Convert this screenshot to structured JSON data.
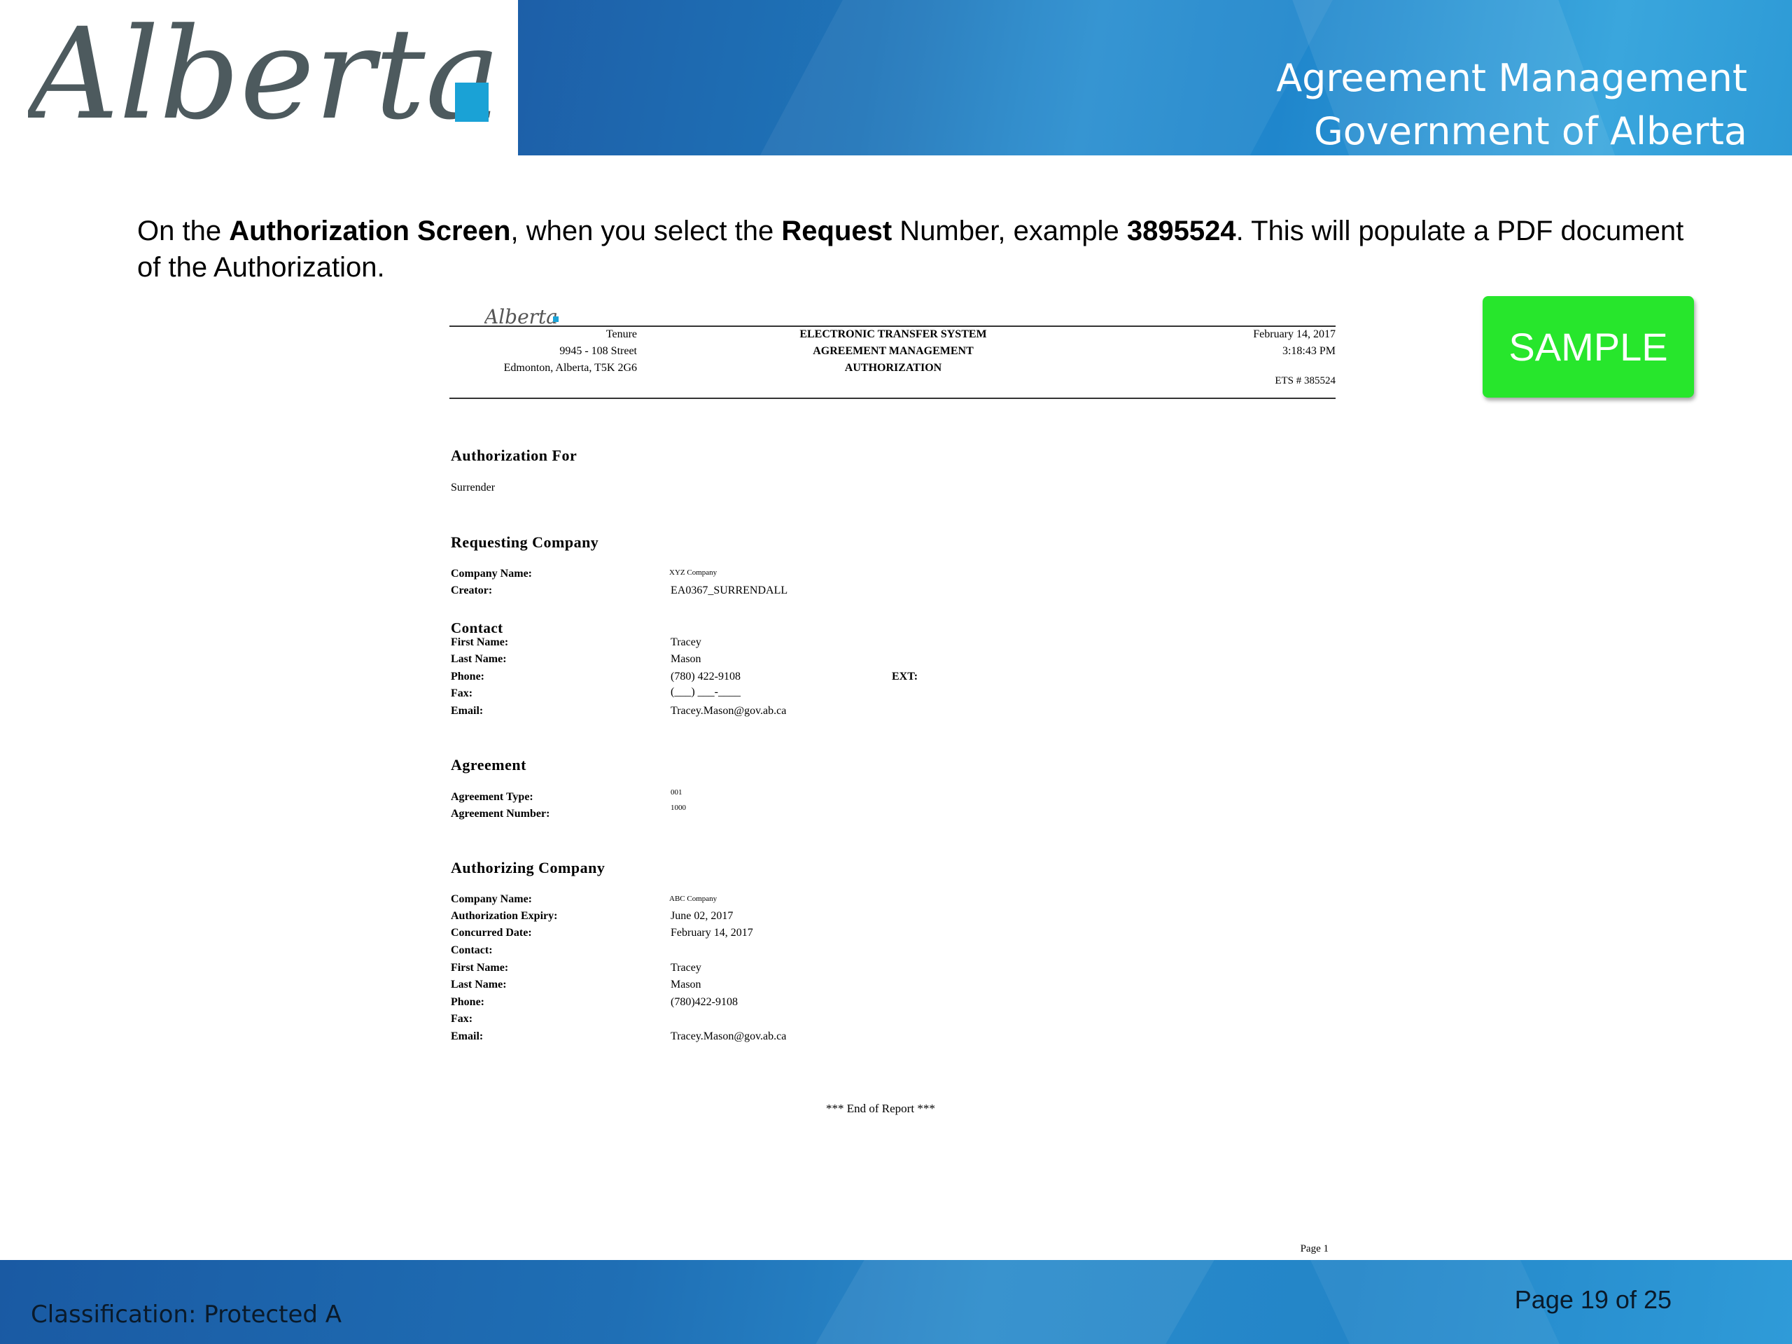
{
  "header": {
    "logo_text": "Alberta",
    "banner_line1": "Agreement Management",
    "banner_line2": "Government of Alberta"
  },
  "intro": {
    "p1": "On the ",
    "b1": "Authorization Screen",
    "p2": ", when you select the ",
    "b2": "Request",
    "p3": " Number, example ",
    "b3": "3895524",
    "p4": ".  This will populate a PDF document of the Authorization."
  },
  "badge": {
    "label": "SAMPLE"
  },
  "pdf": {
    "logo_text": "Alberta",
    "address": [
      "Tenure",
      "9945 - 108 Street",
      "Edmonton, Alberta, T5K 2G6"
    ],
    "title": [
      "ELECTRONIC TRANSFER SYSTEM",
      "AGREEMENT MANAGEMENT",
      "AUTHORIZATION"
    ],
    "date": "February 14, 2017",
    "time": "3:18:43 PM",
    "ets": "ETS # 385524",
    "authorization_for": {
      "heading": "Authorization For",
      "value": "Surrender"
    },
    "requesting_company": {
      "heading": "Requesting Company",
      "company_name_label": "Company Name:",
      "company_name": "XYZ Company",
      "creator_label": "Creator:",
      "creator": "EA0367_SURRENDALL"
    },
    "contact": {
      "heading": "Contact",
      "first_name_label": "First Name:",
      "first_name": "Tracey",
      "last_name_label": "Last Name:",
      "last_name": "Mason",
      "phone_label": "Phone:",
      "phone": "(780) 422-9108",
      "ext_label": "EXT:",
      "fax_label": "Fax:",
      "fax": "(___) ___-____",
      "email_label": "Email:",
      "email": "Tracey.Mason@gov.ab.ca"
    },
    "agreement": {
      "heading": "Agreement",
      "type_label": "Agreement Type:",
      "type": "001",
      "number_label": "Agreement Number:",
      "number": "1000"
    },
    "authorizing_company": {
      "heading": "Authorizing Company",
      "company_name_label": "Company Name:",
      "company_name": "ABC Company",
      "expiry_label": "Authorization Expiry:",
      "expiry": "June 02, 2017",
      "concurred_label": "Concurred Date:",
      "concurred": "February 14, 2017",
      "contact_label": "Contact:",
      "first_name_label": "First Name:",
      "first_name": "Tracey",
      "last_name_label": "Last Name:",
      "last_name": "Mason",
      "phone_label": "Phone:",
      "phone": "(780)422-9108",
      "fax_label": "Fax:",
      "email_label": "Email:",
      "email": "Tracey.Mason@gov.ab.ca"
    },
    "end_of_report": "*** End of Report ***",
    "page": "Page 1"
  },
  "footer": {
    "classification": "Classification: Protected A",
    "page_of": "Page 19 of 25"
  }
}
